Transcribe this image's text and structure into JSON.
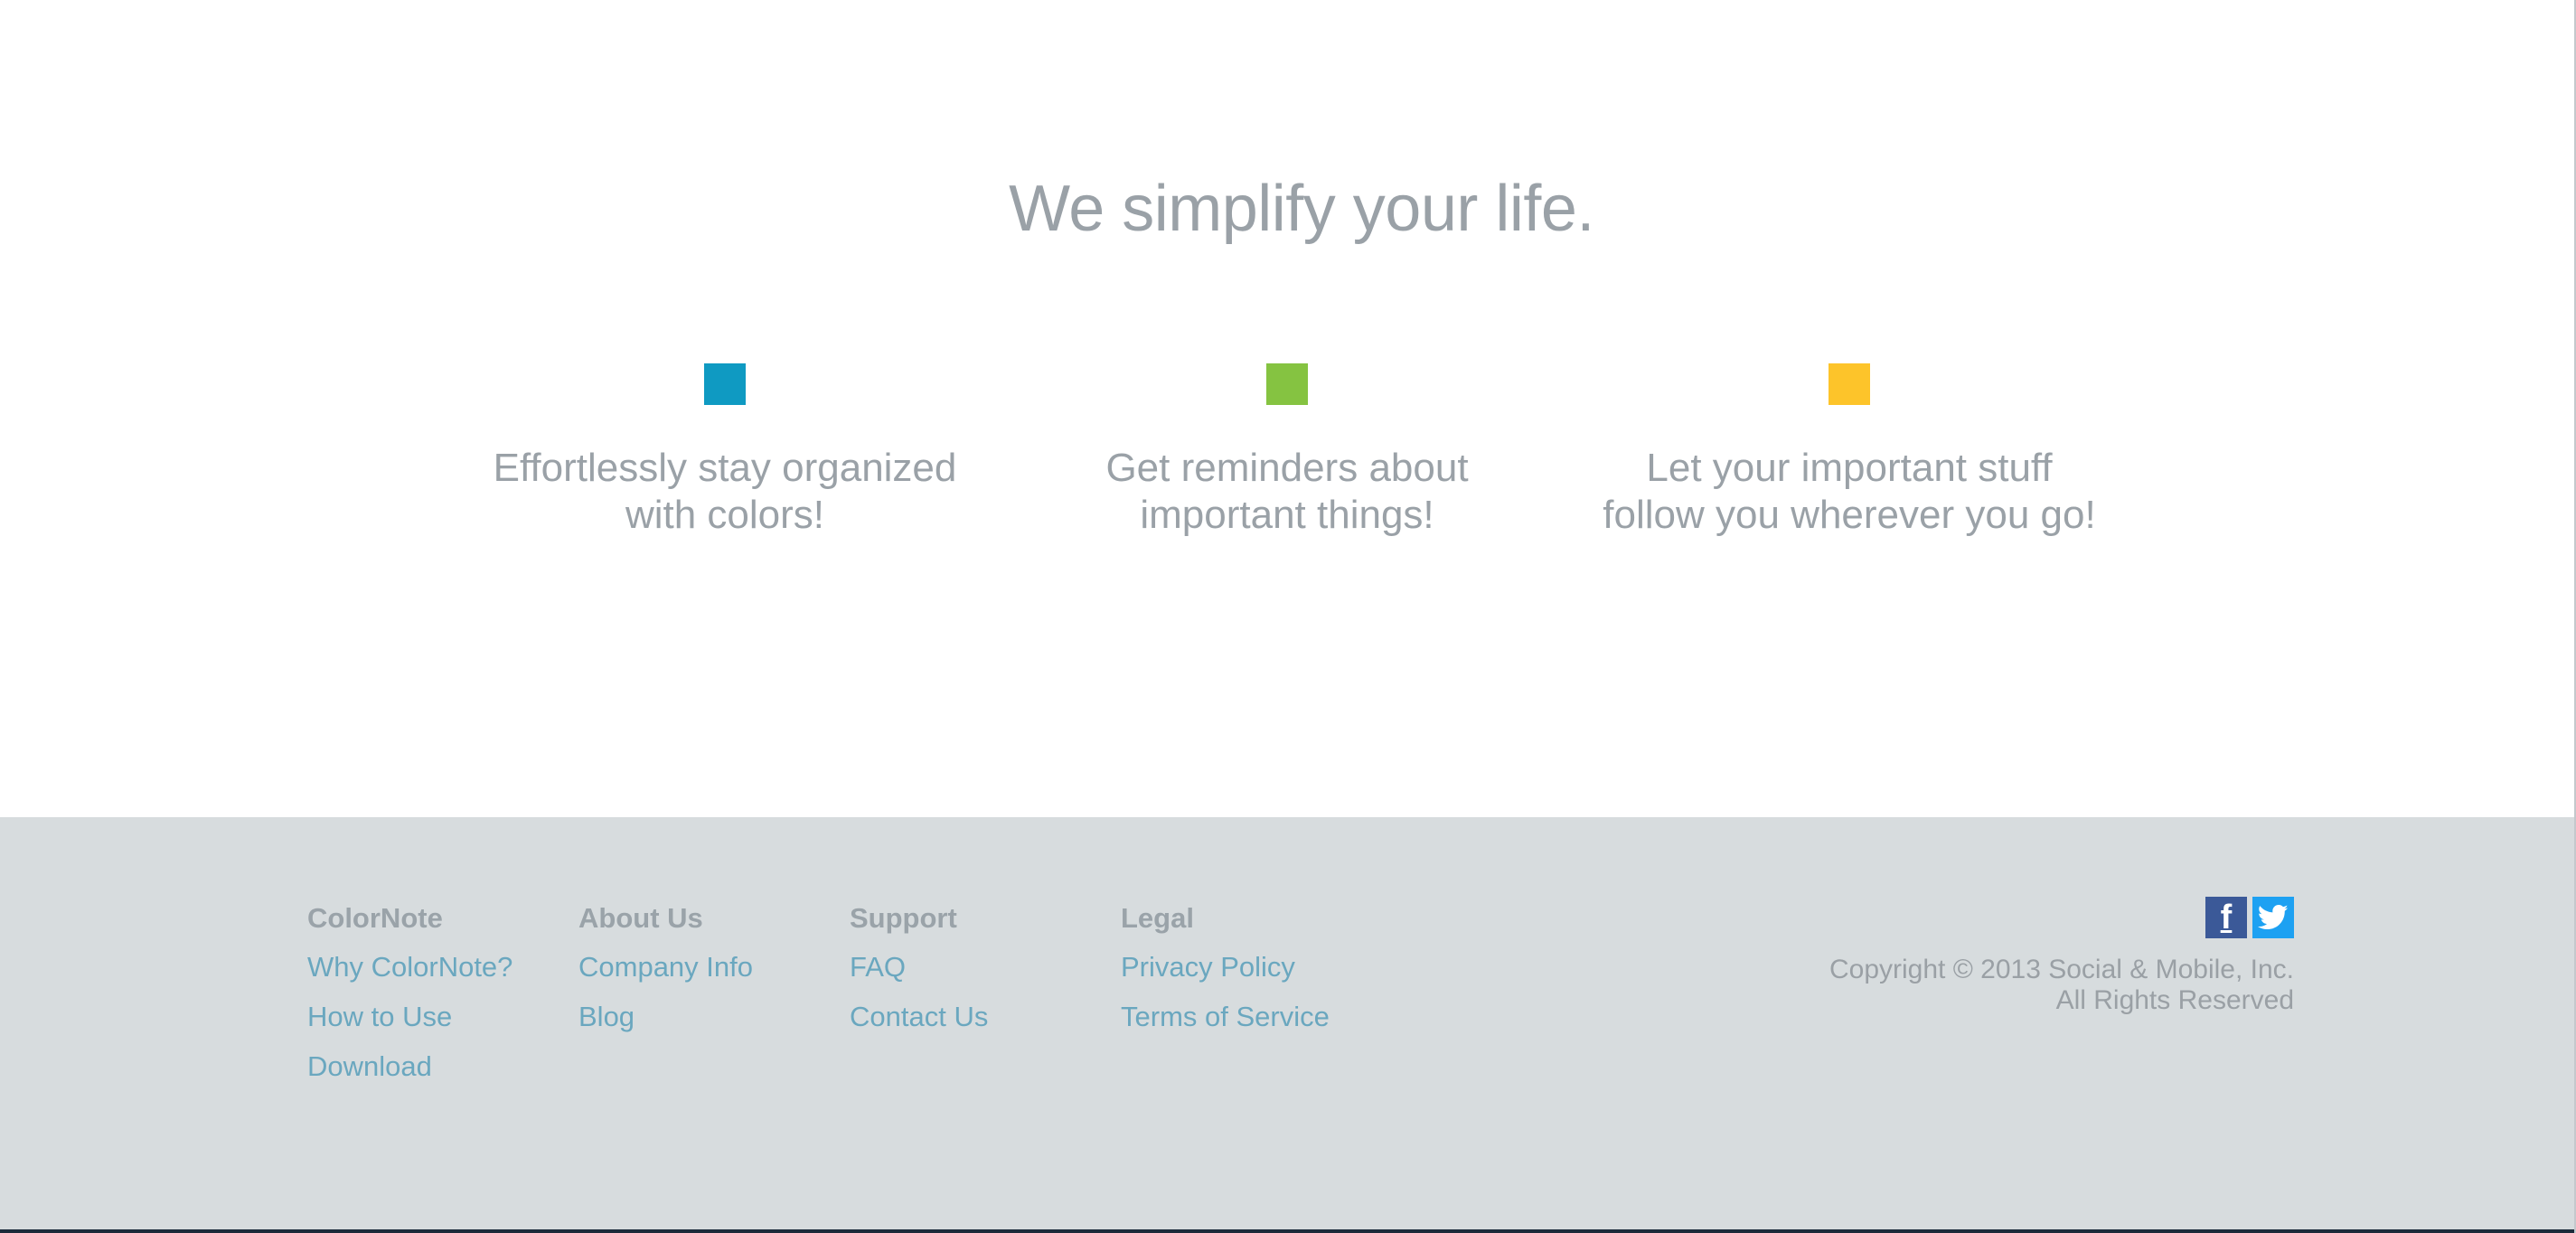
{
  "hero": {
    "title": "We simplify your life."
  },
  "features": [
    {
      "color": "#0f9ac2",
      "text_line1": "Effortlessly stay organized",
      "text_line2": "with colors!"
    },
    {
      "color": "#85c341",
      "text_line1": "Get reminders about",
      "text_line2": "important things!"
    },
    {
      "color": "#fdc42a",
      "text_line1": "Let your important stuff",
      "text_line2": "follow you wherever you go!"
    }
  ],
  "footer": {
    "columns": [
      {
        "heading": "ColorNote",
        "links": [
          "Why ColorNote?",
          "How to Use",
          "Download"
        ]
      },
      {
        "heading": "About Us",
        "links": [
          "Company Info",
          "Blog"
        ]
      },
      {
        "heading": "Support",
        "links": [
          "FAQ",
          "Contact Us"
        ]
      },
      {
        "heading": "Legal",
        "links": [
          "Privacy Policy",
          "Terms of Service"
        ]
      }
    ],
    "social": [
      {
        "name": "facebook-icon",
        "color": "#3b5998"
      },
      {
        "name": "twitter-icon",
        "color": "#1da1f2"
      }
    ],
    "copyright_line1": "Copyright © 2013 Social & Mobile, Inc.",
    "copyright_line2": "All Rights Reserved"
  }
}
